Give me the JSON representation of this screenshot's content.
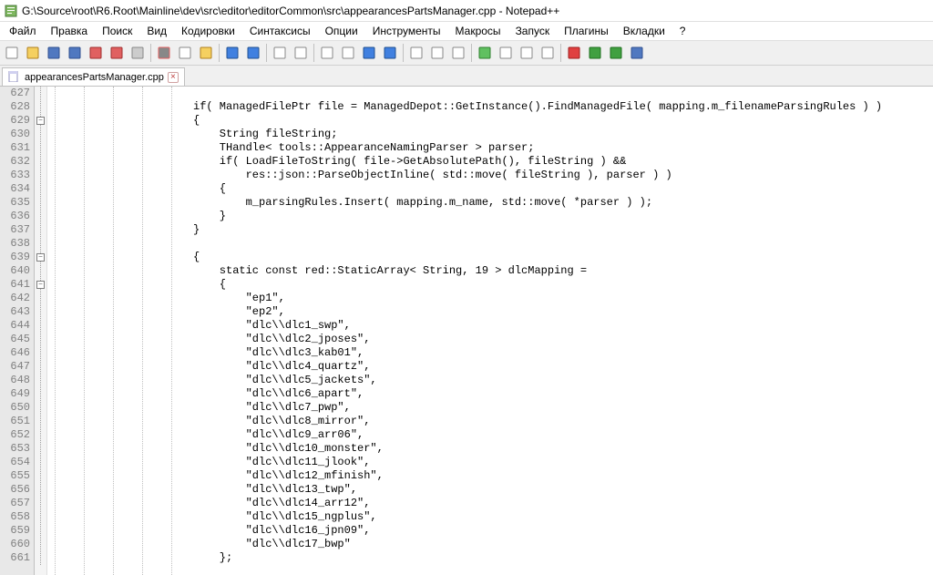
{
  "title": "G:\\Source\\root\\R6.Root\\Mainline\\dev\\src\\editor\\editorCommon\\src\\appearancesPartsManager.cpp - Notepad++",
  "menu": {
    "file": "Файл",
    "edit": "Правка",
    "search": "Поиск",
    "view": "Вид",
    "encoding": "Кодировки",
    "syntax": "Синтаксисы",
    "options": "Опции",
    "tools": "Инструменты",
    "macros": "Макросы",
    "run": "Запуск",
    "plugins": "Плагины",
    "tabs": "Вкладки",
    "help": "?"
  },
  "tab": {
    "filename": "appearancesPartsManager.cpp"
  },
  "line_start": 627,
  "line_end": 661,
  "code_lines": [
    "",
    "if( ManagedFilePtr file = ManagedDepot::GetInstance().FindManagedFile( mapping.m_filenameParsingRules ) )",
    "{",
    "    String fileString;",
    "    THandle< tools::AppearanceNamingParser > parser;",
    "    if( LoadFileToString( file->GetAbsolutePath(), fileString ) &&",
    "        res::json::ParseObjectInline( std::move( fileString ), parser ) )",
    "    {",
    "        m_parsingRules.Insert( mapping.m_name, std::move( *parser ) );",
    "    }",
    "}",
    "",
    "{",
    "    static const red::StaticArray< String, 19 > dlcMapping =",
    "    {",
    "        \"ep1\",",
    "        \"ep2\",",
    "        \"dlc\\\\dlc1_swp\",",
    "        \"dlc\\\\dlc2_jposes\",",
    "        \"dlc\\\\dlc3_kab01\",",
    "        \"dlc\\\\dlc4_quartz\",",
    "        \"dlc\\\\dlc5_jackets\",",
    "        \"dlc\\\\dlc6_apart\",",
    "        \"dlc\\\\dlc7_pwp\",",
    "        \"dlc\\\\dlc8_mirror\",",
    "        \"dlc\\\\dlc9_arr06\",",
    "        \"dlc\\\\dlc10_monster\",",
    "        \"dlc\\\\dlc11_jlook\",",
    "        \"dlc\\\\dlc12_mfinish\",",
    "        \"dlc\\\\dlc13_twp\",",
    "        \"dlc\\\\dlc14_arr12\",",
    "        \"dlc\\\\dlc15_ngplus\",",
    "        \"dlc\\\\dlc16_jpn09\",",
    "        \"dlc\\\\dlc17_bwp\"",
    "    };"
  ],
  "toolbar_icons": [
    "new-file-icon",
    "open-file-icon",
    "save-icon",
    "save-all-icon",
    "close-icon",
    "close-all-icon",
    "print-icon",
    "cut-icon",
    "copy-icon",
    "paste-icon",
    "undo-icon",
    "redo-icon",
    "find-icon",
    "replace-icon",
    "zoom-in-icon",
    "zoom-out-icon",
    "sync-v-icon",
    "sync-h-icon",
    "word-wrap-icon",
    "show-all-chars-icon",
    "indent-guide-icon",
    "lang-icon",
    "fold-icon",
    "unfold-icon",
    "comment-icon",
    "record-macro-icon",
    "play-macro-icon",
    "run-multi-icon",
    "save-macro-icon"
  ]
}
